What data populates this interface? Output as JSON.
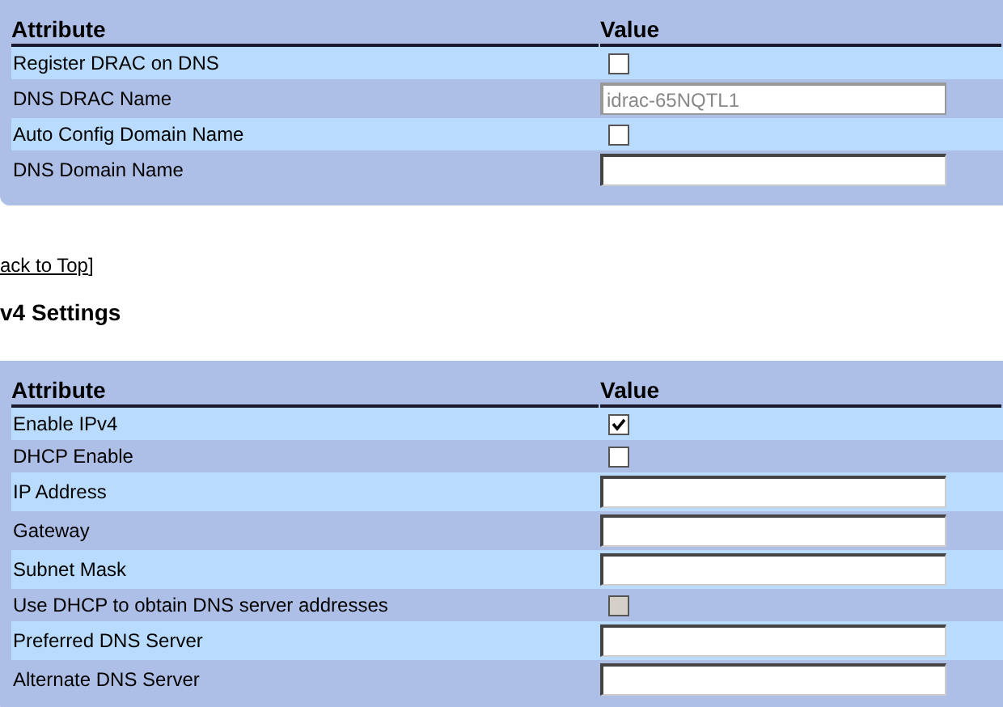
{
  "dns_table": {
    "columns": [
      "Attribute",
      "Value"
    ],
    "rows": [
      {
        "label": "Register DRAC on DNS",
        "kind": "checkbox",
        "checked": false,
        "disabled": false
      },
      {
        "label": "DNS DRAC Name",
        "kind": "input",
        "value": "idrac-65NQTL1",
        "disabled": true
      },
      {
        "label": "Auto Config Domain Name",
        "kind": "checkbox",
        "checked": false,
        "disabled": false
      },
      {
        "label": "DNS Domain Name",
        "kind": "input",
        "value": "",
        "disabled": false
      }
    ]
  },
  "back_link": {
    "text": "ack to Top",
    "bracket": "]"
  },
  "section_title": "v4 Settings",
  "ipv4_table": {
    "columns": [
      "Attribute",
      "Value"
    ],
    "rows": [
      {
        "label": "Enable IPv4",
        "kind": "checkbox",
        "checked": true,
        "disabled": false
      },
      {
        "label": "DHCP Enable",
        "kind": "checkbox",
        "checked": false,
        "disabled": false
      },
      {
        "label": "IP Address",
        "kind": "input",
        "value": "",
        "disabled": false
      },
      {
        "label": "Gateway",
        "kind": "input",
        "value": "",
        "disabled": false
      },
      {
        "label": "Subnet Mask",
        "kind": "input",
        "value": "",
        "disabled": false
      },
      {
        "label": "Use DHCP to obtain DNS server addresses",
        "kind": "checkbox",
        "checked": false,
        "disabled": true
      },
      {
        "label": "Preferred DNS Server",
        "kind": "input",
        "value": "",
        "disabled": false
      },
      {
        "label": "Alternate DNS Server",
        "kind": "input",
        "value": "",
        "disabled": false
      }
    ]
  }
}
